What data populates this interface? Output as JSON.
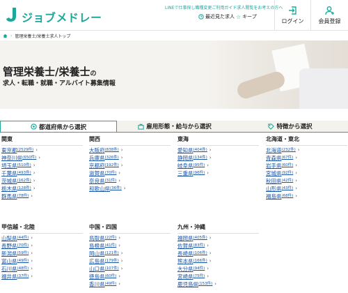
{
  "header": {
    "logo_text": "ジョブメドレー",
    "notice": "LINEで仕事探し職種変更ご利用ガイド求人閲覧をお考えの方へ",
    "recent_label": "最近見た求人",
    "keep_label": "キープ",
    "login_label": "ログイン",
    "register_label": "会員登録"
  },
  "breadcrumb": {
    "home_icon": "home-icon",
    "current": "管理栄養士/栄養士求人トップ"
  },
  "hero": {
    "title": "管理栄養士/栄養士",
    "title_suffix": "の",
    "subtitle": "求人・転職・就職・アルバイト募集情報"
  },
  "tabs": [
    {
      "label": "都道府県から選択",
      "icon": "location-pin-icon",
      "active": true
    },
    {
      "label": "雇用形態・給与から選択",
      "icon": "briefcase-icon",
      "active": false
    },
    {
      "label": "特徴から選択",
      "icon": "tag-icon",
      "active": false
    }
  ],
  "regions": [
    {
      "title": "関東",
      "prefectures": [
        {
          "name": "東京都",
          "count": "(2529件)"
        },
        {
          "name": "神奈川県",
          "count": "(650件)"
        },
        {
          "name": "埼玉県",
          "count": "(510件)"
        },
        {
          "name": "千葉県",
          "count": "(493件)"
        },
        {
          "name": "茨城県",
          "count": "(162件)"
        },
        {
          "name": "栃木県",
          "count": "(128件)"
        },
        {
          "name": "群馬県",
          "count": "(78件)"
        }
      ]
    },
    {
      "title": "関西",
      "prefectures": [
        {
          "name": "大阪府",
          "count": "(838件)"
        },
        {
          "name": "兵庫県",
          "count": "(326件)"
        },
        {
          "name": "京都府",
          "count": "(192件)"
        },
        {
          "name": "滋賀県",
          "count": "(70件)"
        },
        {
          "name": "奈良県",
          "count": "(31件)"
        },
        {
          "name": "和歌山県",
          "count": "(36件)"
        }
      ]
    },
    {
      "title": "東海",
      "prefectures": [
        {
          "name": "愛知県",
          "count": "(404件)"
        },
        {
          "name": "静岡県",
          "count": "(134件)"
        },
        {
          "name": "岐阜県",
          "count": "(95件)"
        },
        {
          "name": "三重県",
          "count": "(96件)"
        }
      ]
    },
    {
      "title": "北海道・東北",
      "prefectures": [
        {
          "name": "北海道",
          "count": "(232件)"
        },
        {
          "name": "青森県",
          "count": "(67件)"
        },
        {
          "name": "岩手県",
          "count": "(60件)"
        },
        {
          "name": "宮城県",
          "count": "(92件)"
        },
        {
          "name": "秋田県",
          "count": "(42件)"
        },
        {
          "name": "山形県",
          "count": "(43件)"
        },
        {
          "name": "福島県",
          "count": "(68件)"
        }
      ]
    },
    {
      "title": "甲信越・北陸",
      "prefectures": [
        {
          "name": "山梨県",
          "count": "(44件)"
        },
        {
          "name": "長野県",
          "count": "(70件)"
        },
        {
          "name": "新潟県",
          "count": "(59件)"
        },
        {
          "name": "富山県",
          "count": "(49件)"
        },
        {
          "name": "石川県",
          "count": "(48件)"
        },
        {
          "name": "福井県",
          "count": "(37件)"
        }
      ]
    },
    {
      "title": "中国・四国",
      "prefectures": [
        {
          "name": "鳥取県",
          "count": "(22件)"
        },
        {
          "name": "島根県",
          "count": "(41件)"
        },
        {
          "name": "岡山県",
          "count": "(121件)"
        },
        {
          "name": "広島県",
          "count": "(179件)"
        },
        {
          "name": "山口県",
          "count": "(107件)"
        },
        {
          "name": "徳島県",
          "count": "(60件)"
        },
        {
          "name": "香川県",
          "count": "(49件)"
        }
      ]
    },
    {
      "title": "九州・沖縄",
      "prefectures": [
        {
          "name": "福岡県",
          "count": "(405件)"
        },
        {
          "name": "佐賀県",
          "count": "(83件)"
        },
        {
          "name": "長崎県",
          "count": "(106件)"
        },
        {
          "name": "熊本県",
          "count": "(166件)"
        },
        {
          "name": "大分県",
          "count": "(94件)"
        },
        {
          "name": "宮崎県",
          "count": "(75件)"
        },
        {
          "name": "鹿児島県",
          "count": "(153件)"
        }
      ]
    }
  ],
  "colors": {
    "brand": "#1ca99c",
    "link": "#1a55a5"
  }
}
